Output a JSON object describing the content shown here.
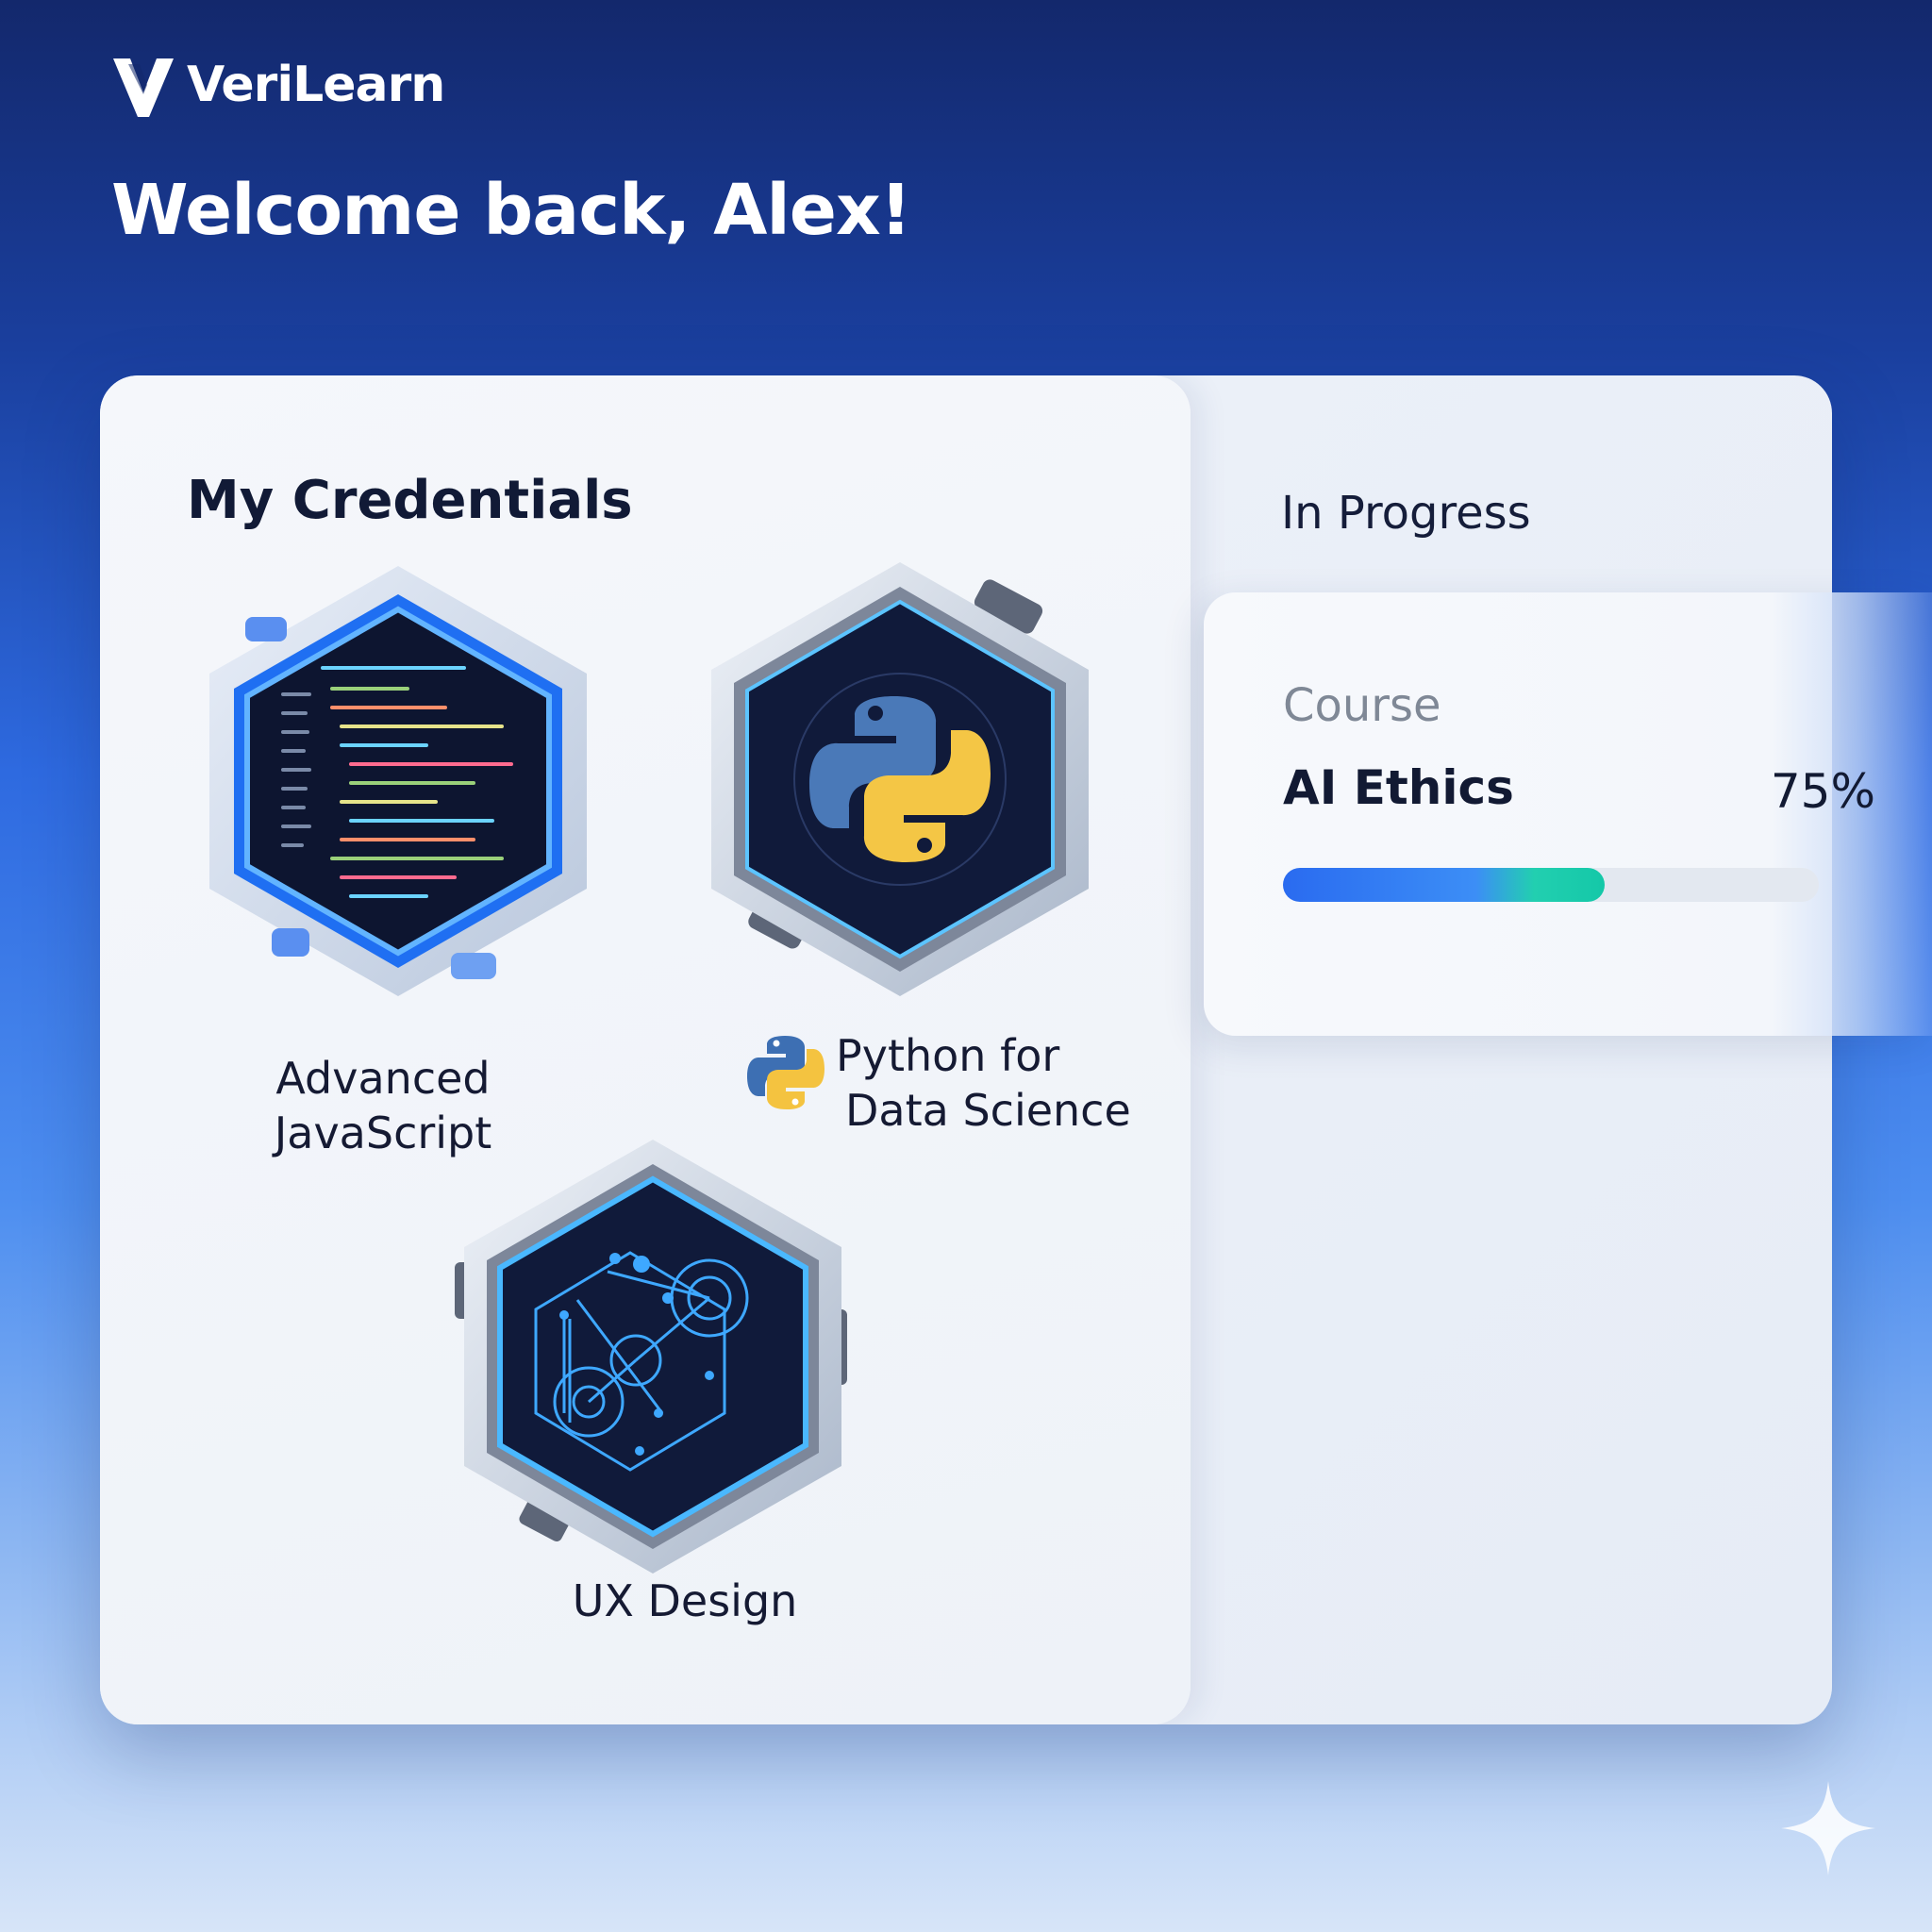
{
  "brand": {
    "name": "VeriLearn",
    "logo_icon": "verilearn-v-logo-icon"
  },
  "header": {
    "welcome": "Welcome back, Alex!"
  },
  "credentials": {
    "title": "My Credentials",
    "items": [
      {
        "label_line1": "Advanced",
        "label_line2": "JavaScript",
        "icon": "code-screen-badge-icon"
      },
      {
        "label_line1": "Python for",
        "label_line2": "Data Science",
        "icon": "python-badge-icon"
      },
      {
        "label_line1": "UX Design",
        "icon": "ux-network-badge-icon"
      }
    ]
  },
  "in_progress": {
    "title": "In Progress",
    "course": {
      "caption": "Course",
      "name": "AI Ethics",
      "percent_text": "75%",
      "progress": 0.6
    }
  },
  "colors": {
    "background_top": "#13286c",
    "accent_blue": "#2a6bf0",
    "accent_teal": "#14c8a8",
    "badge_dark": "#101a3a"
  }
}
